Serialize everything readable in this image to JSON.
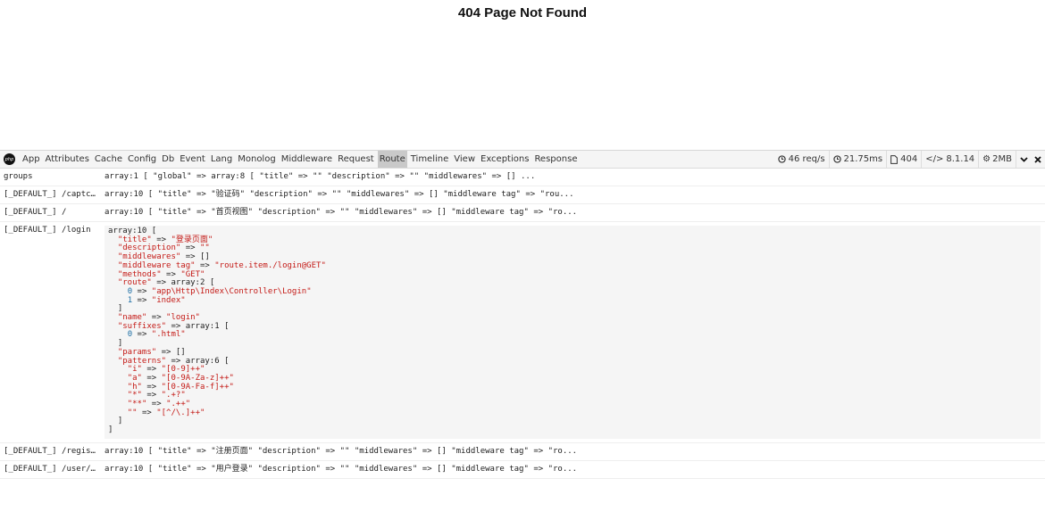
{
  "page": {
    "title": "404 Page Not Found"
  },
  "toolbar": {
    "tabs": [
      "App",
      "Attributes",
      "Cache",
      "Config",
      "Db",
      "Event",
      "Lang",
      "Monolog",
      "Middleware",
      "Request",
      "Route",
      "Timeline",
      "View",
      "Exceptions",
      "Response"
    ],
    "active_tab": "Route",
    "indicators": {
      "requests": "46 req/s",
      "time": "21.75ms",
      "status": "404",
      "version": "8.1.14",
      "memory": "2MB"
    }
  },
  "rows": [
    {
      "key": "groups",
      "value": "array:1 [ \"global\" => array:8 [ \"title\" => \"\" \"description\" => \"\" \"middlewares\" => [] ..."
    },
    {
      "key": "[_DEFAULT_] /captc…",
      "value": "array:10 [ \"title\" => \"验证码\" \"description\" => \"\" \"middlewares\" => [] \"middleware tag\" => \"rou..."
    },
    {
      "key": "[_DEFAULT_] /",
      "value": "array:10 [ \"title\" => \"首页视图\" \"description\" => \"\" \"middlewares\" => [] \"middleware tag\" => \"ro..."
    },
    {
      "key": "[_DEFAULT_] /login",
      "expanded": true
    },
    {
      "key": "[_DEFAULT_] /regis…",
      "value": "array:10 [ \"title\" => \"注册页面\" \"description\" => \"\" \"middlewares\" => [] \"middleware tag\" => \"ro..."
    },
    {
      "key": "[_DEFAULT_] /user/…",
      "value": "array:10 [ \"title\" => \"用户登录\" \"description\" => \"\" \"middlewares\" => [] \"middleware tag\" => \"ro..."
    }
  ],
  "login_dump": {
    "header": "array:10 [",
    "title_key": "\"title\"",
    "title_val": "\"登录页面\"",
    "description_key": "\"description\"",
    "description_val": "\"\"",
    "middlewares_key": "\"middlewares\"",
    "middlewares_val": "[]",
    "middleware_tag_key": "\"middleware tag\"",
    "middleware_tag_val": "\"route.item./login@GET\"",
    "methods_key": "\"methods\"",
    "methods_val": "\"GET\"",
    "route_key": "\"route\"",
    "route_type": "array:2 [",
    "route_0_idx": "0",
    "route_0_val": "\"app\\Http\\Index\\Controller\\Login\"",
    "route_1_idx": "1",
    "route_1_val": "\"index\"",
    "name_key": "\"name\"",
    "name_val": "\"login\"",
    "suffixes_key": "\"suffixes\"",
    "suffixes_type": "array:1 [",
    "suffix_0_idx": "0",
    "suffix_0_val": "\".html\"",
    "params_key": "\"params\"",
    "params_val": "[]",
    "patterns_key": "\"patterns\"",
    "patterns_type": "array:6 [",
    "p_i_key": "\"i\"",
    "p_i_val": "\"[0-9]++\"",
    "p_a_key": "\"a\"",
    "p_a_val": "\"[0-9A-Za-z]++\"",
    "p_h_key": "\"h\"",
    "p_h_val": "\"[0-9A-Fa-f]++\"",
    "p_star_key": "\"*\"",
    "p_star_val": "\".+?\"",
    "p_dstar_key": "\"**\"",
    "p_dstar_val": "\".++\"",
    "p_empty_key": "\"\"",
    "p_empty_val": "\"[^/\\.]++\"",
    "arrow": "=>",
    "close": "]"
  }
}
